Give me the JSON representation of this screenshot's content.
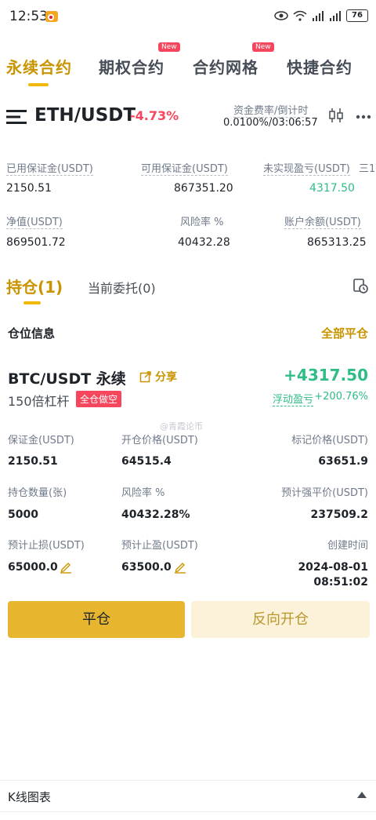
{
  "status": {
    "time": "12:53",
    "battery": "76"
  },
  "tabs": [
    {
      "label": "永续合约",
      "active": true,
      "new": false
    },
    {
      "label": "期权合约",
      "active": false,
      "new": true
    },
    {
      "label": "合约网格",
      "active": false,
      "new": true
    },
    {
      "label": "快捷合约",
      "active": false,
      "new": false
    }
  ],
  "new_badge": "New",
  "pair": {
    "name": "ETH/USDT",
    "change": "-4.73%",
    "funding_label": "资金费率/倒计时",
    "funding_value": "0.0100%/03:06:57"
  },
  "account": {
    "used_margin_label": "已用保证金(USDT)",
    "used_margin": "2150.51",
    "avail_margin_label": "可用保证金(USDT)",
    "avail_margin": "867351.20",
    "upnl_label": "未实现盈亏(USDT)",
    "upnl": "4317.50",
    "cut_label": "三1",
    "equity_label": "净值(USDT)",
    "equity": "869501.72",
    "risk_label": "风险率 %",
    "risk": "40432.28",
    "balance_label": "账户余额(USDT)",
    "balance": "865313.25"
  },
  "position_tabs": {
    "holdings": "持仓(1)",
    "orders": "当前委托(0)"
  },
  "position_info": {
    "title": "仓位信息",
    "close_all": "全部平仓"
  },
  "position": {
    "symbol": "BTC/USDT 永续",
    "share": "分享",
    "pnl": "+4317.50",
    "leverage": "150倍杠杆",
    "side": "全仓做空",
    "pnl_label": "浮动盈亏",
    "pnl_pct": "+200.76%",
    "fields": {
      "margin_label": "保证金(USDT)",
      "margin": "2150.51",
      "open_price_label": "开仓价格(USDT)",
      "open_price": "64515.4",
      "mark_price_label": "标记价格(USDT)",
      "mark_price": "63651.9",
      "qty_label": "持仓数量(张)",
      "qty": "5000",
      "risk_label": "风险率 %",
      "risk": "40432.28%",
      "liq_label": "预计强平价(USDT)",
      "liq": "237509.2",
      "sl_label": "预计止损(USDT)",
      "sl": "65000.0",
      "tp_label": "预计止盈(USDT)",
      "tp": "63500.0",
      "created_label": "创建时间",
      "created_date": "2024-08-01",
      "created_time": "08:51:02"
    }
  },
  "watermark": "@青霞论币",
  "buttons": {
    "close": "平仓",
    "reverse": "反向开仓"
  },
  "kline": {
    "label": "K线图表"
  },
  "colors": {
    "accent": "#f0b90b",
    "green": "#2ebd85",
    "red": "#f6465d"
  }
}
